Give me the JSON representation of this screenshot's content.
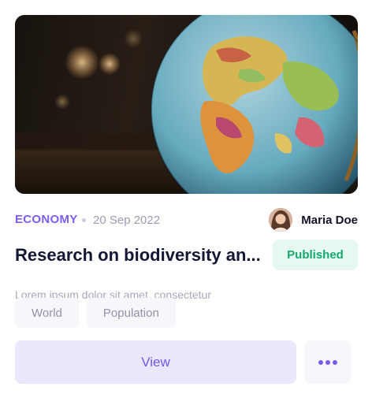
{
  "card": {
    "image_subject": "globe-photo",
    "category": "ECONOMY",
    "date": "20 Sep 2022",
    "author": {
      "name": "Maria Doe"
    },
    "title": "Research on biodiversity an...",
    "status": "Published",
    "description": "Lorem ipsum dolor sit amet, consectetur",
    "tags": [
      {
        "label": "World"
      },
      {
        "label": "Population"
      }
    ],
    "actions": {
      "view_label": "View",
      "more_icon": "more-dots-icon"
    }
  },
  "colors": {
    "accent": "#7c5cf5",
    "status_bg": "#e7f8f1",
    "status_text": "#15a86f",
    "view_bg": "#ebe8fe",
    "title": "#141734"
  }
}
